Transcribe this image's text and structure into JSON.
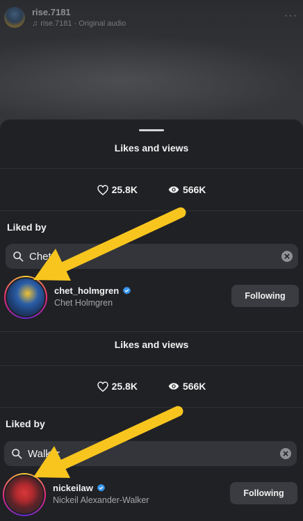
{
  "reel": {
    "username": "rise.7181",
    "audio": "rise.7181 · Original audio",
    "more": "···"
  },
  "panels": [
    {
      "title": "Likes and views",
      "likes": "25.8K",
      "views": "566K",
      "liked_by_label": "Liked by",
      "search_value": "Chet",
      "result": {
        "username": "chet_holmgren",
        "full_name": "Chet Holmgren",
        "verified": true,
        "button_label": "Following"
      }
    },
    {
      "title": "Likes and views",
      "likes": "25.8K",
      "views": "566K",
      "liked_by_label": "Liked by",
      "search_value": "Walker",
      "result": {
        "username": "nickeilaw",
        "full_name": "Nickeil Alexander-Walker",
        "verified": true,
        "button_label": "Following"
      }
    }
  ],
  "colors": {
    "sheet_bg": "#202125",
    "search_bg": "#33353a",
    "button_bg": "#3a3c41",
    "verified_blue": "#3897f0",
    "arrow_yellow": "#f7c51e"
  },
  "icons": {
    "likes": "heart-icon",
    "views": "eye-icon",
    "search": "search-icon",
    "clear": "clear-icon",
    "verified": "verified-badge-icon",
    "annotation": "yellow-arrow-icon"
  }
}
